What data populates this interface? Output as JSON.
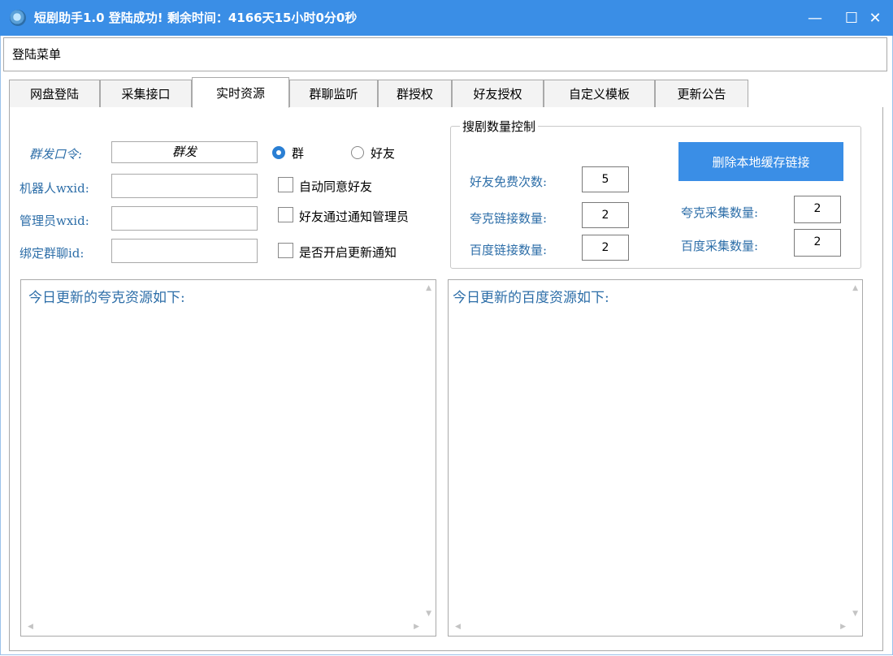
{
  "window": {
    "title": "短剧助手1.0  登陆成功! 剩余时间：4166天15小时0分0秒",
    "minimize_glyph": "—",
    "maximize_glyph": "☐",
    "close_glyph": "✕"
  },
  "menu": {
    "login_menu": "登陆菜单"
  },
  "tabs": [
    {
      "label": "网盘登陆"
    },
    {
      "label": "采集接口"
    },
    {
      "label": "实时资源",
      "active": true
    },
    {
      "label": "群聊监听"
    },
    {
      "label": "群授权"
    },
    {
      "label": "好友授权"
    },
    {
      "label": "自定义模板"
    },
    {
      "label": "更新公告"
    }
  ],
  "form": {
    "mass_command_label": "群发口令:",
    "mass_command_value": "群发",
    "radio_group": "群",
    "radio_friend": "好友",
    "radio_selected": "群",
    "robot_wxid_label": "机器人wxid:",
    "robot_wxid_value": "",
    "admin_wxid_label": "管理员wxid:",
    "admin_wxid_value": "",
    "bind_group_label": "绑定群聊id:",
    "bind_group_value": "",
    "auto_accept_friend": "自动同意好友",
    "notify_admin_on_friend": "好友通过通知管理员",
    "enable_update_notice": "是否开启更新通知"
  },
  "group": {
    "title": "搜剧数量控制",
    "free_times_label": "好友免费次数:",
    "free_times_value": "5",
    "quark_link_count_label": "夸克链接数量:",
    "quark_link_count_value": "2",
    "baidu_link_count_label": "百度链接数量:",
    "baidu_link_count_value": "2",
    "delete_cache_button": "删除本地缓存链接",
    "quark_collect_count_label": "夸克采集数量:",
    "quark_collect_count_value": "2",
    "baidu_collect_count_label": "百度采集数量:",
    "baidu_collect_count_value": "2"
  },
  "textareas": {
    "quark_text": "今日更新的夸克资源如下:",
    "baidu_text": "今日更新的百度资源如下:"
  },
  "colors": {
    "titlebar": "#3a8ee6",
    "accent": "#2a7fd4",
    "label_blue": "#2d6ea8"
  }
}
